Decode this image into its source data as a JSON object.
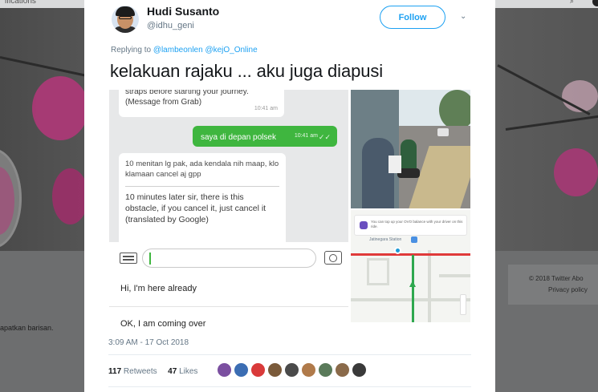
{
  "background": {
    "top_bar_text": "ifications",
    "sidebar_snippet": "apatkan barisan.",
    "footer_line1": "© 2018 Twitter   Abo",
    "footer_line2": "Privacy policy"
  },
  "tweet": {
    "author_name": "Hudi Susanto",
    "author_handle": "@idhu_geni",
    "follow_label": "Follow",
    "chevron": "⌄",
    "replying_prefix": "Replying to",
    "replying_mentions": "@lambeonlen @kejO_Online",
    "text": "kelakuan rajaku ... aku juga diapusi",
    "timestamp": "3:09 AM - 17 Oct 2018",
    "retweets_count": "117",
    "retweets_label": "Retweets",
    "likes_count": "47",
    "likes_label": "Likes",
    "liker_colors": [
      "#7b4fa0",
      "#3b6db3",
      "#d93a3a",
      "#7a5a3a",
      "#4a4a4a",
      "#b07a4a",
      "#5a7a5a",
      "#8a6a4a",
      "#3a3a3a"
    ]
  },
  "chat": {
    "bubble1_text": "straps before starting your journey.\n(Message from Grab)",
    "bubble1_time": "10:41 am",
    "bubble2_text": "saya di depan polsek",
    "bubble2_time": "10:41 am",
    "bubble2_check": "✓✓",
    "bubble3_indonesian": "10 menitan lg pak, ada kendala nih maap, klo klamaan cancel aj gpp",
    "bubble3_english": "10 minutes later sir, there is this obstacle, if you cancel it, just cancel it (translated by Google)",
    "quick_reply_1": "Hi, I'm here already",
    "quick_reply_2": "OK, I am coming over"
  },
  "map": {
    "banner_text": "You can top up your OVO balance with your driver on this ride.",
    "label": "Jatinegara Station"
  }
}
